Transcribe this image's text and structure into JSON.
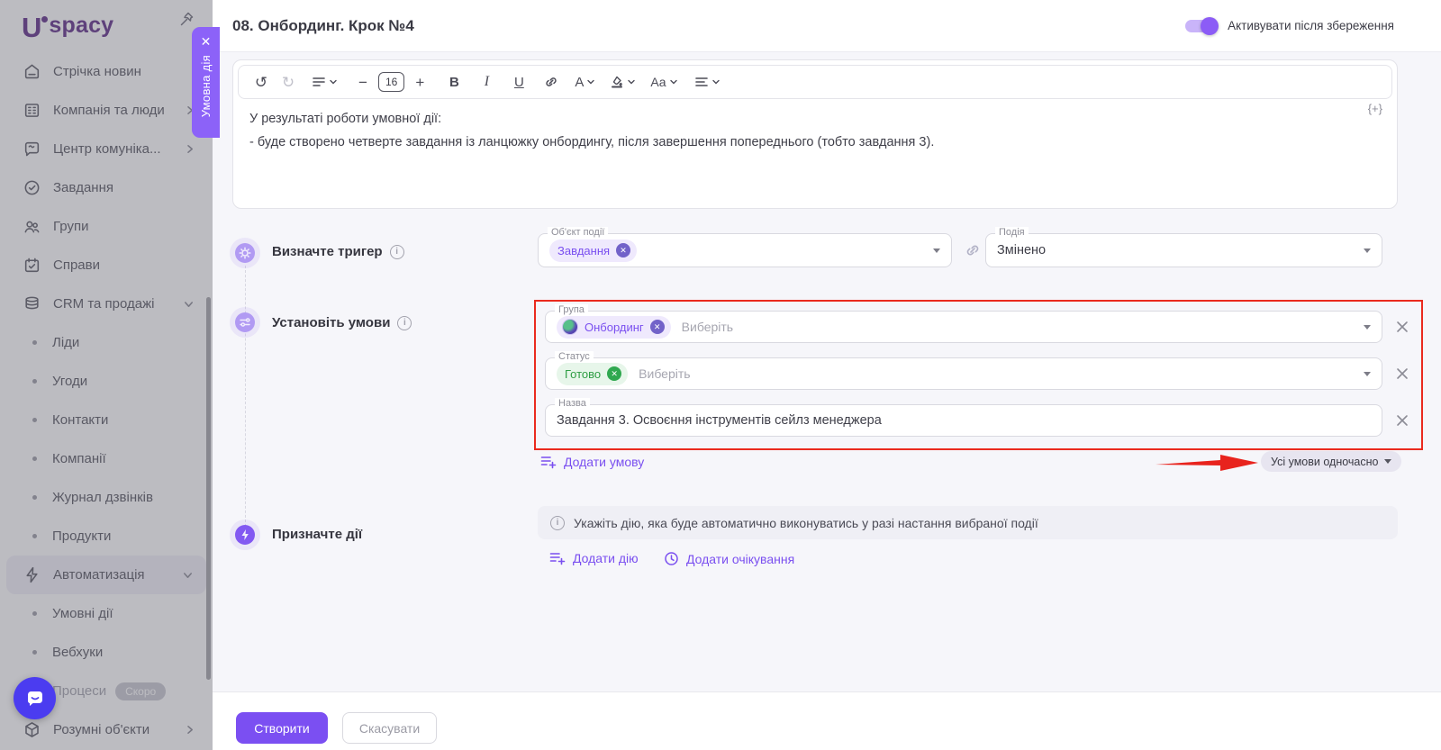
{
  "brand": {
    "logo_u": "U",
    "logo_rest": "spacy"
  },
  "sidebar": {
    "items": [
      {
        "label": "Стрічка новин",
        "icon": "newsfeed",
        "type": "main"
      },
      {
        "label": "Компанія та люди",
        "icon": "company",
        "type": "main",
        "chevron": "right"
      },
      {
        "label": "Центр комуніка...",
        "icon": "comms",
        "type": "main",
        "chevron": "right"
      },
      {
        "label": "Завдання",
        "icon": "tasks",
        "type": "main"
      },
      {
        "label": "Групи",
        "icon": "groups",
        "type": "main"
      },
      {
        "label": "Справи",
        "icon": "calendar",
        "type": "main"
      },
      {
        "label": "CRM та продажі",
        "icon": "crm",
        "type": "main",
        "chevron": "down"
      },
      {
        "label": "Ліди",
        "type": "sub"
      },
      {
        "label": "Угоди",
        "type": "sub"
      },
      {
        "label": "Контакти",
        "type": "sub"
      },
      {
        "label": "Компанії",
        "type": "sub"
      },
      {
        "label": "Журнал дзвінків",
        "type": "sub"
      },
      {
        "label": "Продукти",
        "type": "sub"
      },
      {
        "label": "Автоматизація",
        "icon": "automation",
        "type": "main",
        "chevron": "down",
        "active": true
      },
      {
        "label": "Умовні дії",
        "type": "sub"
      },
      {
        "label": "Вебхуки",
        "type": "sub"
      },
      {
        "label": "Процеси",
        "type": "sub",
        "badge": "Скоро",
        "disabled": true
      },
      {
        "label": "Розумні об'єкти",
        "icon": "objects",
        "type": "main",
        "chevron": "right"
      }
    ]
  },
  "header": {
    "title": "08. Онбординг. Крок №4",
    "toggle_label": "Активувати після збереження",
    "toggle_on": true
  },
  "tab": {
    "label": "Умовна дія",
    "close": "✕"
  },
  "editor": {
    "font_size": "16",
    "line1": "У результаті роботи умовної дії:",
    "line2": "- буде створено четверте завдання із ланцюжку онбордингу, після завершення попереднього (тобто завдання 3).",
    "insert_token": "{+}"
  },
  "trigger": {
    "title": "Визначте тригер",
    "object_label": "Об'єкт події",
    "object_chip": "Завдання",
    "event_label": "Подія",
    "event_value": "Змінено"
  },
  "conditions": {
    "title": "Установіть умови",
    "group_label": "Група",
    "group_chip": "Онбординг",
    "group_placeholder": "Виберіть",
    "status_label": "Статус",
    "status_chip": "Готово",
    "status_placeholder": "Виберіть",
    "name_label": "Назва",
    "name_value": "Завдання 3. Освоєння інструментів сейлз менеджера",
    "add_condition": "Додати умову",
    "logic_selector": "Усі умови одночасно"
  },
  "actions": {
    "title": "Призначте дії",
    "hint": "Укажіть дію, яка буде автоматично виконуватись у разі настання вибраної події",
    "add_action": "Додати дію",
    "add_wait": "Додати очікування"
  },
  "footer": {
    "create": "Створити",
    "cancel": "Скасувати"
  },
  "colors": {
    "accent": "#7a4ff0",
    "tab": "#8c62f8",
    "toggle": "#8c5cf6",
    "annotation": "#ea2a1e",
    "chip_green": "#2f9e44",
    "brand": "#5e2b87"
  }
}
